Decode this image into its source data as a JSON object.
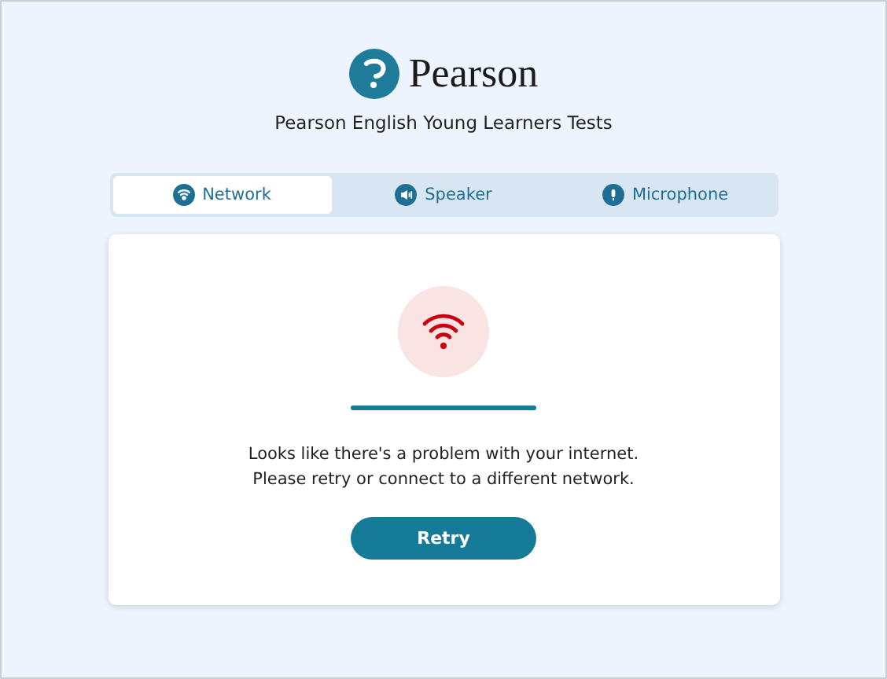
{
  "brand": {
    "name": "Pearson",
    "subtitle": "Pearson English Young Learners Tests"
  },
  "tabs": [
    {
      "label": "Network",
      "kind": "network",
      "selected": true
    },
    {
      "label": "Speaker",
      "kind": "speaker",
      "selected": false
    },
    {
      "label": "Microphone",
      "kind": "microphone",
      "selected": false
    }
  ],
  "status": {
    "kind": "error",
    "level": 1,
    "message_lines": [
      "Looks like there's a problem with your internet.",
      "Please retry or connect to a different network."
    ]
  },
  "buttons": [
    {
      "label": "Retry"
    }
  ]
}
